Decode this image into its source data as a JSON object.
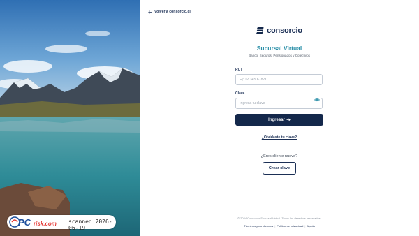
{
  "nav": {
    "back_label": "Volver a consorcio.cl"
  },
  "brand": {
    "logo_text": "consorcio",
    "color_primary": "#14284b",
    "color_accent": "#2a8fa8"
  },
  "header": {
    "title": "Sucursal Virtual",
    "subtitle": "Banco, Seguros, Pensionados y Colectivos"
  },
  "form": {
    "rut_label": "RUT",
    "rut_placeholder": "Ej: 12.345.678-9",
    "rut_value": "",
    "password_label": "Clave",
    "password_placeholder": "Ingresa tu clave",
    "password_value": "",
    "submit_label": "Ingresar"
  },
  "links": {
    "forgot_password": "¿Olvidaste tu clave?",
    "new_client_prompt": "¿Eres cliente nuevo?",
    "create_password": "Crear clave"
  },
  "footer": {
    "copyright": "© 2024 Consorcio Sucursal Virtual. Todos los derechos reservados.",
    "links": [
      "Términos y condiciones",
      "Política de privacidad",
      "Ayuda"
    ]
  },
  "watermark": {
    "brand_pc": "PC",
    "brand_site": "risk.com",
    "stamp": "scanned 2026-06-19"
  },
  "icons": {
    "back": "arrow-left-icon",
    "logo": "consorcio-logo-icon",
    "password_toggle": "eye-icon",
    "submit": "arrow-right-icon"
  }
}
